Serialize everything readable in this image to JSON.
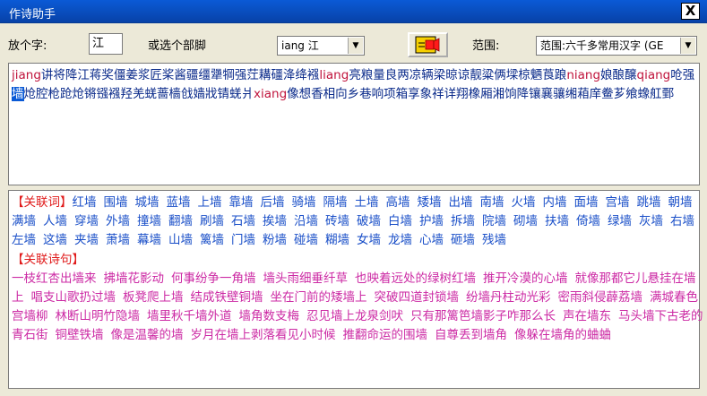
{
  "window": {
    "title": "作诗助手",
    "close_label": "X"
  },
  "toolbar": {
    "char_label": "放个字:",
    "char_value": "江",
    "radical_label": "或选个部脚",
    "radical_value": "iang 江",
    "range_label": "范围:",
    "range_value": "范围:六千多常用汉字 (GE"
  },
  "rhyme_line1": "讲将降江蒋奖僵姜浆匠桨酱疆缰犟犅强茳耩礓洚绛襁",
  "rhyme_line1b": "亮粮量良两凉辆梁晾谅靓粱俩墚椋魉莨踉",
  "rhyme_line2a": "娘酿醸",
  "rhyme_line2b": "呛强",
  "rhyme_hl": "墙",
  "rhyme_line2c": "炝腔枪跄炝锵镪襁羟羌蜣蔷樯戗嫱戕锖蜣爿",
  "rhyme_line2d": "像想香相向乡巷响项箱享象祥详翔",
  "rhyme_line3": "橡厢湘饷降镶襄骧缃葙庠鲞芗飨蟓舡鄄",
  "pinyin": {
    "jiang": "jiang",
    "liang": "liang",
    "niang": "niang",
    "qiang": "qiang",
    "xiang": "xiang"
  },
  "assoc": {
    "words_header": "【关联词】",
    "words": [
      "红墙",
      "围墙",
      "城墙",
      "蓝墙",
      "上墙",
      "靠墙",
      "后墙",
      "骑墙",
      "隔墙",
      "土墙",
      "高墙",
      "矮墙",
      "出墙",
      "南墙",
      "火墙",
      "内墙",
      "面墙",
      "宫墙",
      "跳墙",
      "朝墙",
      "满墙",
      "人墙",
      "穿墙",
      "外墙",
      "撞墙",
      "翻墙",
      "刷墙",
      "石墙",
      "挨墙",
      "沿墙",
      "砖墙",
      "破墙",
      "白墙",
      "护墙",
      "拆墙",
      "院墙",
      "砌墙",
      "扶墙",
      "倚墙",
      "绿墙",
      "灰墙",
      "右墙",
      "左墙",
      "这墙",
      "夹墙",
      "萧墙",
      "幕墙",
      "山墙",
      "篱墙",
      "门墙",
      "粉墙",
      "碰墙",
      "糊墙",
      "女墙",
      "龙墙",
      "心墙",
      "砸墙",
      "残墙"
    ],
    "lines_header": "【关联诗句】",
    "lines": [
      "一枝红杏出墙来",
      "拂墙花影动",
      "何事纷争一角墙",
      "墙头雨细垂纤草",
      "也映着远处的绿树红墙",
      "推开冷漠的心墙",
      "就像那都它儿悬挂在墙上",
      "唱支山歌扔过墙",
      "板凳爬上墙",
      "结成铁壁铜墙",
      "坐在门前的矮墙上",
      "突破四道封锁墙",
      "纷墙丹柱动光彩",
      "密雨斜侵薜荔墙",
      "满城春色宫墙柳",
      "林断山明竹隐墙",
      "墙里秋千墙外道",
      "墙角数支梅",
      "忍见墙上龙泉剑吠",
      "只有那篱笆墙影子咋那么长",
      "声在墙东",
      "马头墙下古老的青石街",
      "铜壁铁墙",
      "像是温馨的墙",
      "岁月在墙上剥落看见小时候",
      "推翻命运的围墙",
      "自尊丢到墙角",
      "像躲在墙角的蛐蛐"
    ]
  }
}
